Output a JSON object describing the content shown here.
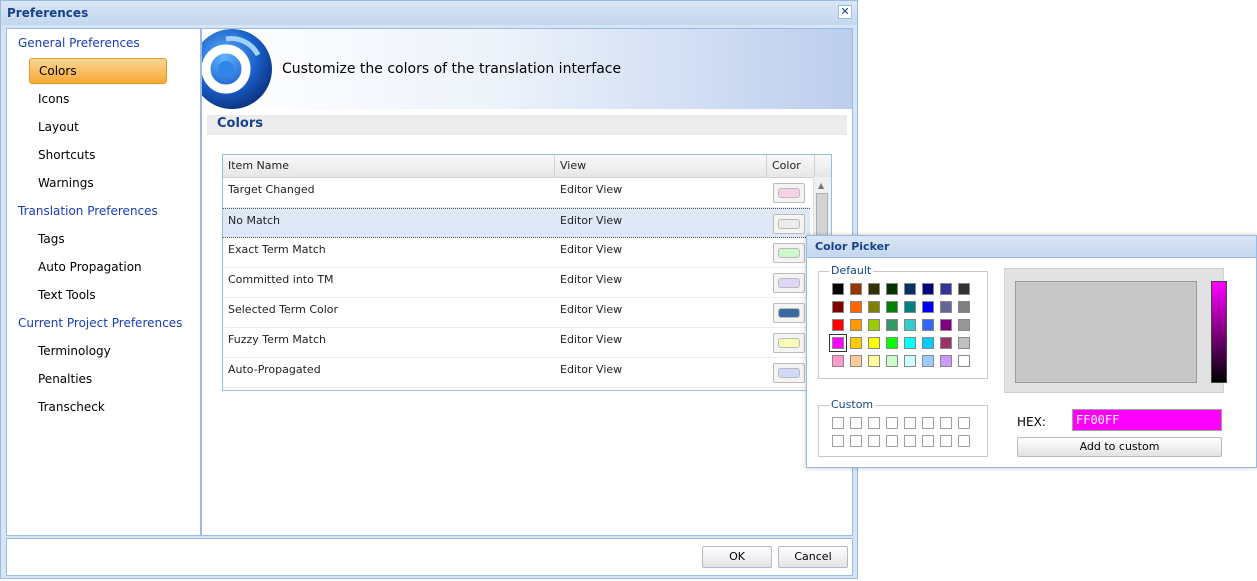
{
  "window": {
    "title": "Preferences",
    "close_label": "✕"
  },
  "sidebar": {
    "groups": [
      {
        "label": "General Preferences",
        "items": [
          "Colors",
          "Icons",
          "Layout",
          "Shortcuts",
          "Warnings"
        ]
      },
      {
        "label": "Translation Preferences",
        "items": [
          "Tags",
          "Auto Propagation",
          "Text Tools"
        ]
      },
      {
        "label": "Current Project Preferences",
        "items": [
          "Terminology",
          "Penalties",
          "Transcheck"
        ]
      }
    ],
    "selected": "Colors"
  },
  "banner": {
    "text": "Customize the colors of the translation interface",
    "logo_icon": "swirl-logo-icon"
  },
  "section": {
    "title": "Colors"
  },
  "grid": {
    "columns": [
      "Item Name",
      "View",
      "Color"
    ],
    "rows": [
      {
        "name": "Target Changed",
        "view": "Editor View",
        "color": "#f8d0e8"
      },
      {
        "name": "No Match",
        "view": "Editor View",
        "color": "#ececec"
      },
      {
        "name": "Exact Term Match",
        "view": "Editor View",
        "color": "#cdf7cd"
      },
      {
        "name": "Committed into TM",
        "view": "Editor View",
        "color": "#e0d4f7"
      },
      {
        "name": "Selected Term Color",
        "view": "Editor View",
        "color": "#3b6aa0"
      },
      {
        "name": "Fuzzy Term Match",
        "view": "Editor View",
        "color": "#fbfbb8"
      },
      {
        "name": "Auto-Propagated",
        "view": "Editor View",
        "color": "#cfdaf9"
      }
    ],
    "selected_row": 1
  },
  "footer": {
    "ok_label": "OK",
    "cancel_label": "Cancel"
  },
  "picker": {
    "title": "Color Picker",
    "default_label": "Default",
    "custom_label": "Custom",
    "hex_label": "HEX:",
    "hex_value": "FF00FF",
    "add_label": "Add to custom",
    "selected_color": "#ff00ff",
    "palette": [
      [
        "#000000",
        "#993300",
        "#333300",
        "#003300",
        "#003366",
        "#000080",
        "#333399",
        "#333333"
      ],
      [
        "#800000",
        "#ff6600",
        "#808000",
        "#008000",
        "#008080",
        "#0000ff",
        "#666699",
        "#808080"
      ],
      [
        "#ff0000",
        "#ff9900",
        "#99cc00",
        "#339966",
        "#33cccc",
        "#3366ff",
        "#800080",
        "#969696"
      ],
      [
        "#ff00ff",
        "#ffcc00",
        "#ffff00",
        "#00ff00",
        "#00ffff",
        "#00ccff",
        "#993366",
        "#c0c0c0"
      ],
      [
        "#ff99cc",
        "#ffcc99",
        "#ffff99",
        "#ccffcc",
        "#ccffff",
        "#99ccff",
        "#cc99ff",
        "#ffffff"
      ]
    ],
    "custom_slots": 16
  }
}
